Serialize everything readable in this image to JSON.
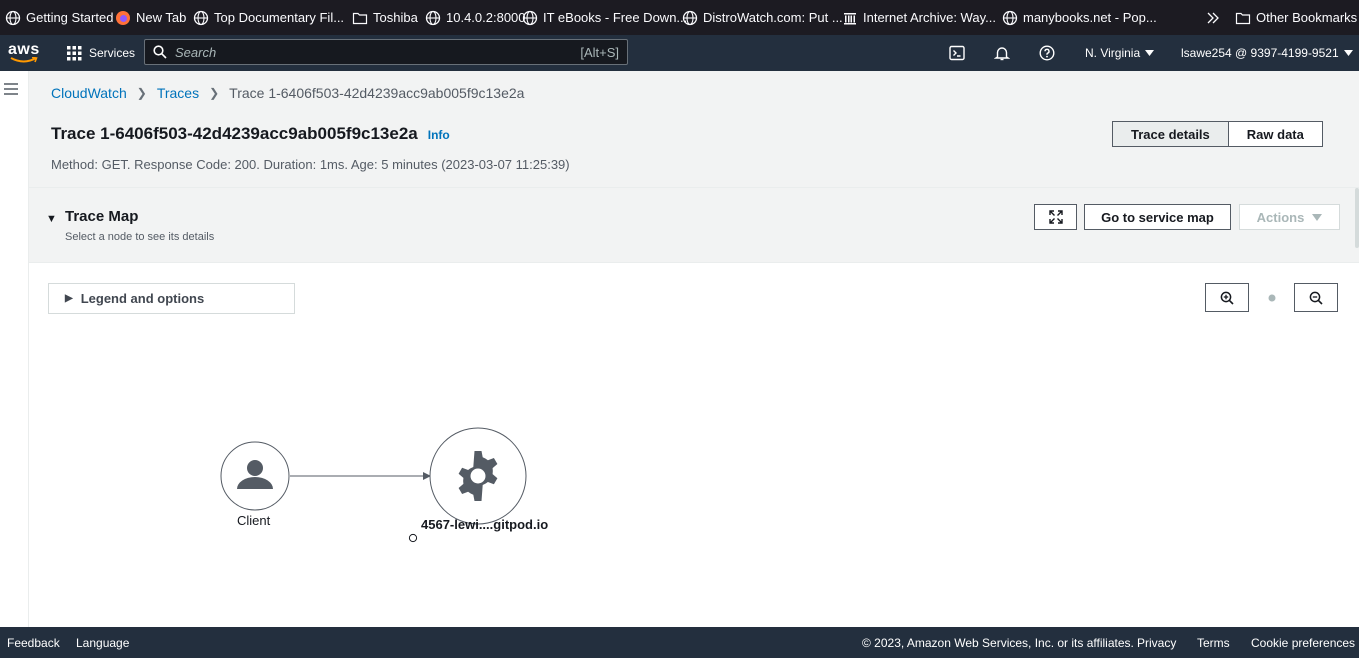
{
  "bookmarks": [
    {
      "label": "Getting Started",
      "icon": "globe-icon"
    },
    {
      "label": "New Tab",
      "icon": "firefox-icon"
    },
    {
      "label": "Top Documentary Fil...",
      "icon": "globe-icon"
    },
    {
      "label": "Toshiba",
      "icon": "folder-icon"
    },
    {
      "label": "10.4.0.2:8000",
      "icon": "globe-icon"
    },
    {
      "label": "IT eBooks - Free Down...",
      "icon": "globe-icon"
    },
    {
      "label": "DistroWatch.com: Put ...",
      "icon": "globe-icon"
    },
    {
      "label": "Internet Archive: Way...",
      "icon": "archive-icon"
    },
    {
      "label": "manybooks.net - Pop...",
      "icon": "globe-icon"
    }
  ],
  "bookmarks_overflow_icon": "double-chevron-icon",
  "other_bookmarks": "Other Bookmarks",
  "nav": {
    "logo": "aws",
    "services": "Services",
    "search_placeholder": "Search",
    "search_shortcut": "[Alt+S]",
    "region": "N. Virginia",
    "account": "lsawe254 @ 9397-4199-9521"
  },
  "breadcrumb": {
    "root": "CloudWatch",
    "section": "Traces",
    "current": "Trace 1-6406f503-42d4239acc9ab005f9c13e2a"
  },
  "page": {
    "title": "Trace 1-6406f503-42d4239acc9ab005f9c13e2a",
    "info": "Info",
    "subtitle": "Method: GET. Response Code: 200. Duration: 1ms. Age: 5 minutes (2023-03-07 11:25:39)",
    "tabs": [
      "Trace details",
      "Raw data"
    ],
    "active_tab": "Trace details"
  },
  "trace_map": {
    "title": "Trace Map",
    "description": "Select a node to see its details",
    "goto_service_map": "Go to service map",
    "actions": "Actions",
    "legend": "Legend and options",
    "nodes": [
      {
        "label": "Client",
        "icon": "user-icon"
      },
      {
        "label": "4567-lewi....gitpod.io",
        "icon": "gear-icon"
      }
    ]
  },
  "footer": {
    "feedback": "Feedback",
    "language": "Language",
    "copyright": "© 2023, Amazon Web Services, Inc. or its affiliates.",
    "privacy": "Privacy",
    "terms": "Terms",
    "cookies": "Cookie preferences"
  },
  "colors": {
    "nav_bg": "#232f3e",
    "link": "#0073bb",
    "bookmarks_bg": "#1c1b22"
  }
}
